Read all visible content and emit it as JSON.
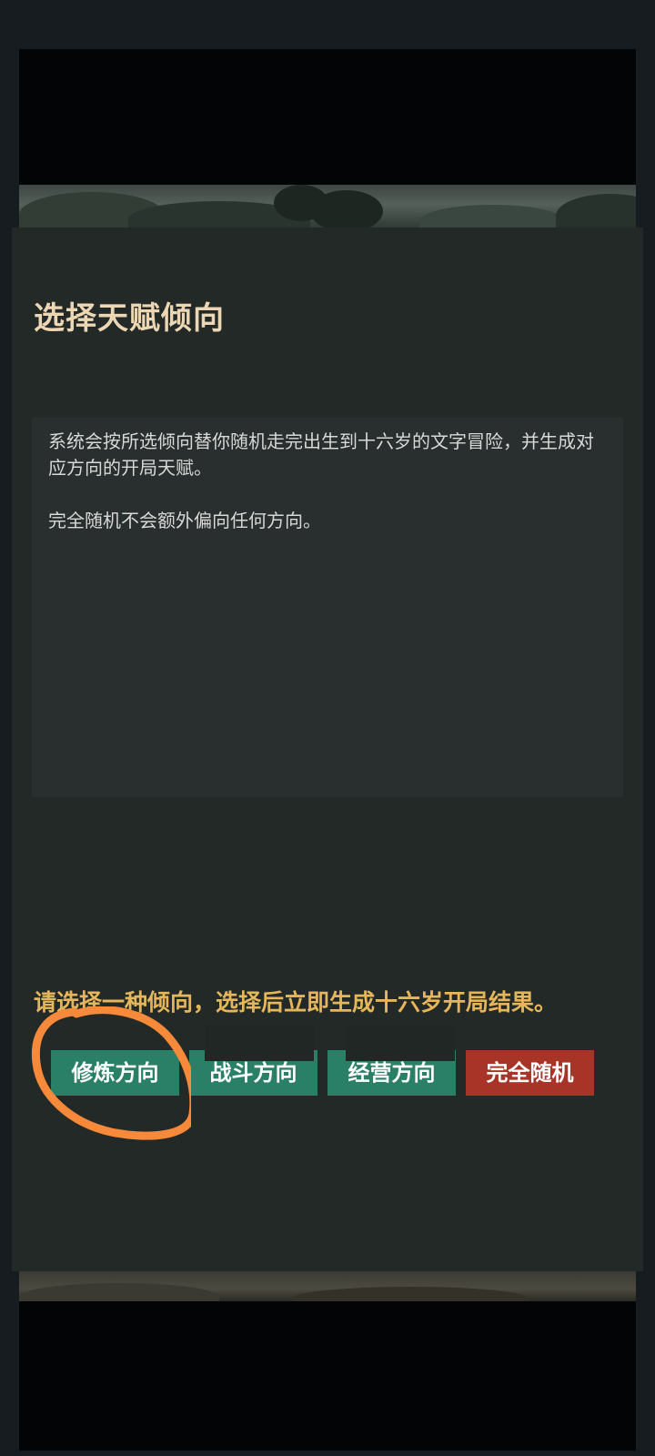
{
  "dialog": {
    "title": "选择天赋倾向",
    "description_lines": [
      "系统会按所选倾向替你随机走完出生到十六岁的文字冒险，并生成对应方向的开局天赋。",
      "完全随机不会额外偏向任何方向。"
    ],
    "prompt": "请选择一种倾向，选择后立即生成十六岁开局结果。",
    "buttons": [
      {
        "label": "修炼方向",
        "color": "#2a8066"
      },
      {
        "label": "战斗方向",
        "color": "#2a8066"
      },
      {
        "label": "经营方向",
        "color": "#2a8066"
      },
      {
        "label": "完全随机",
        "color": "#a73426"
      }
    ]
  },
  "annotation": {
    "color": "#f7893a",
    "shape": "circle-highlight"
  }
}
